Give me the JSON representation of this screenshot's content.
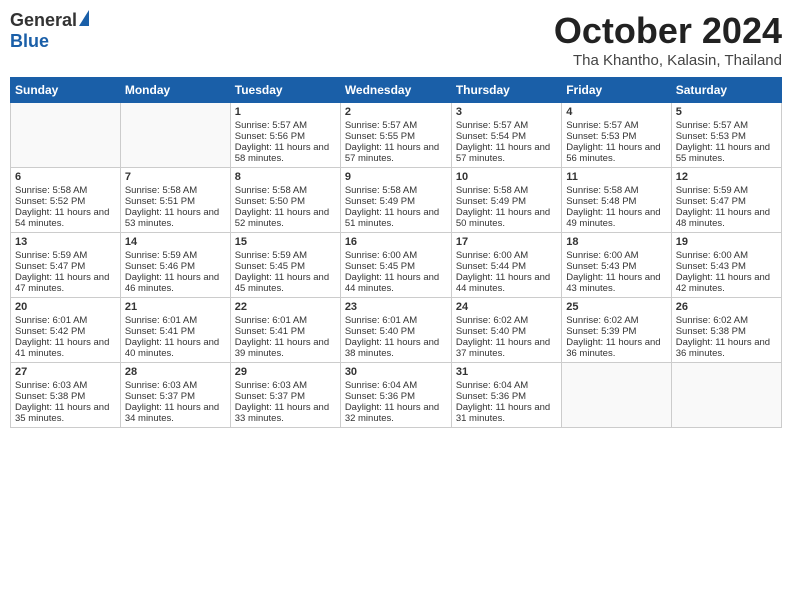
{
  "header": {
    "logo_general": "General",
    "logo_blue": "Blue",
    "month": "October 2024",
    "location": "Tha Khantho, Kalasin, Thailand"
  },
  "weekdays": [
    "Sunday",
    "Monday",
    "Tuesday",
    "Wednesday",
    "Thursday",
    "Friday",
    "Saturday"
  ],
  "weeks": [
    [
      {
        "day": "",
        "text": ""
      },
      {
        "day": "",
        "text": ""
      },
      {
        "day": "1",
        "text": "Sunrise: 5:57 AM\nSunset: 5:56 PM\nDaylight: 11 hours and 58 minutes."
      },
      {
        "day": "2",
        "text": "Sunrise: 5:57 AM\nSunset: 5:55 PM\nDaylight: 11 hours and 57 minutes."
      },
      {
        "day": "3",
        "text": "Sunrise: 5:57 AM\nSunset: 5:54 PM\nDaylight: 11 hours and 57 minutes."
      },
      {
        "day": "4",
        "text": "Sunrise: 5:57 AM\nSunset: 5:53 PM\nDaylight: 11 hours and 56 minutes."
      },
      {
        "day": "5",
        "text": "Sunrise: 5:57 AM\nSunset: 5:53 PM\nDaylight: 11 hours and 55 minutes."
      }
    ],
    [
      {
        "day": "6",
        "text": "Sunrise: 5:58 AM\nSunset: 5:52 PM\nDaylight: 11 hours and 54 minutes."
      },
      {
        "day": "7",
        "text": "Sunrise: 5:58 AM\nSunset: 5:51 PM\nDaylight: 11 hours and 53 minutes."
      },
      {
        "day": "8",
        "text": "Sunrise: 5:58 AM\nSunset: 5:50 PM\nDaylight: 11 hours and 52 minutes."
      },
      {
        "day": "9",
        "text": "Sunrise: 5:58 AM\nSunset: 5:49 PM\nDaylight: 11 hours and 51 minutes."
      },
      {
        "day": "10",
        "text": "Sunrise: 5:58 AM\nSunset: 5:49 PM\nDaylight: 11 hours and 50 minutes."
      },
      {
        "day": "11",
        "text": "Sunrise: 5:58 AM\nSunset: 5:48 PM\nDaylight: 11 hours and 49 minutes."
      },
      {
        "day": "12",
        "text": "Sunrise: 5:59 AM\nSunset: 5:47 PM\nDaylight: 11 hours and 48 minutes."
      }
    ],
    [
      {
        "day": "13",
        "text": "Sunrise: 5:59 AM\nSunset: 5:47 PM\nDaylight: 11 hours and 47 minutes."
      },
      {
        "day": "14",
        "text": "Sunrise: 5:59 AM\nSunset: 5:46 PM\nDaylight: 11 hours and 46 minutes."
      },
      {
        "day": "15",
        "text": "Sunrise: 5:59 AM\nSunset: 5:45 PM\nDaylight: 11 hours and 45 minutes."
      },
      {
        "day": "16",
        "text": "Sunrise: 6:00 AM\nSunset: 5:45 PM\nDaylight: 11 hours and 44 minutes."
      },
      {
        "day": "17",
        "text": "Sunrise: 6:00 AM\nSunset: 5:44 PM\nDaylight: 11 hours and 44 minutes."
      },
      {
        "day": "18",
        "text": "Sunrise: 6:00 AM\nSunset: 5:43 PM\nDaylight: 11 hours and 43 minutes."
      },
      {
        "day": "19",
        "text": "Sunrise: 6:00 AM\nSunset: 5:43 PM\nDaylight: 11 hours and 42 minutes."
      }
    ],
    [
      {
        "day": "20",
        "text": "Sunrise: 6:01 AM\nSunset: 5:42 PM\nDaylight: 11 hours and 41 minutes."
      },
      {
        "day": "21",
        "text": "Sunrise: 6:01 AM\nSunset: 5:41 PM\nDaylight: 11 hours and 40 minutes."
      },
      {
        "day": "22",
        "text": "Sunrise: 6:01 AM\nSunset: 5:41 PM\nDaylight: 11 hours and 39 minutes."
      },
      {
        "day": "23",
        "text": "Sunrise: 6:01 AM\nSunset: 5:40 PM\nDaylight: 11 hours and 38 minutes."
      },
      {
        "day": "24",
        "text": "Sunrise: 6:02 AM\nSunset: 5:40 PM\nDaylight: 11 hours and 37 minutes."
      },
      {
        "day": "25",
        "text": "Sunrise: 6:02 AM\nSunset: 5:39 PM\nDaylight: 11 hours and 36 minutes."
      },
      {
        "day": "26",
        "text": "Sunrise: 6:02 AM\nSunset: 5:38 PM\nDaylight: 11 hours and 36 minutes."
      }
    ],
    [
      {
        "day": "27",
        "text": "Sunrise: 6:03 AM\nSunset: 5:38 PM\nDaylight: 11 hours and 35 minutes."
      },
      {
        "day": "28",
        "text": "Sunrise: 6:03 AM\nSunset: 5:37 PM\nDaylight: 11 hours and 34 minutes."
      },
      {
        "day": "29",
        "text": "Sunrise: 6:03 AM\nSunset: 5:37 PM\nDaylight: 11 hours and 33 minutes."
      },
      {
        "day": "30",
        "text": "Sunrise: 6:04 AM\nSunset: 5:36 PM\nDaylight: 11 hours and 32 minutes."
      },
      {
        "day": "31",
        "text": "Sunrise: 6:04 AM\nSunset: 5:36 PM\nDaylight: 11 hours and 31 minutes."
      },
      {
        "day": "",
        "text": ""
      },
      {
        "day": "",
        "text": ""
      }
    ]
  ]
}
